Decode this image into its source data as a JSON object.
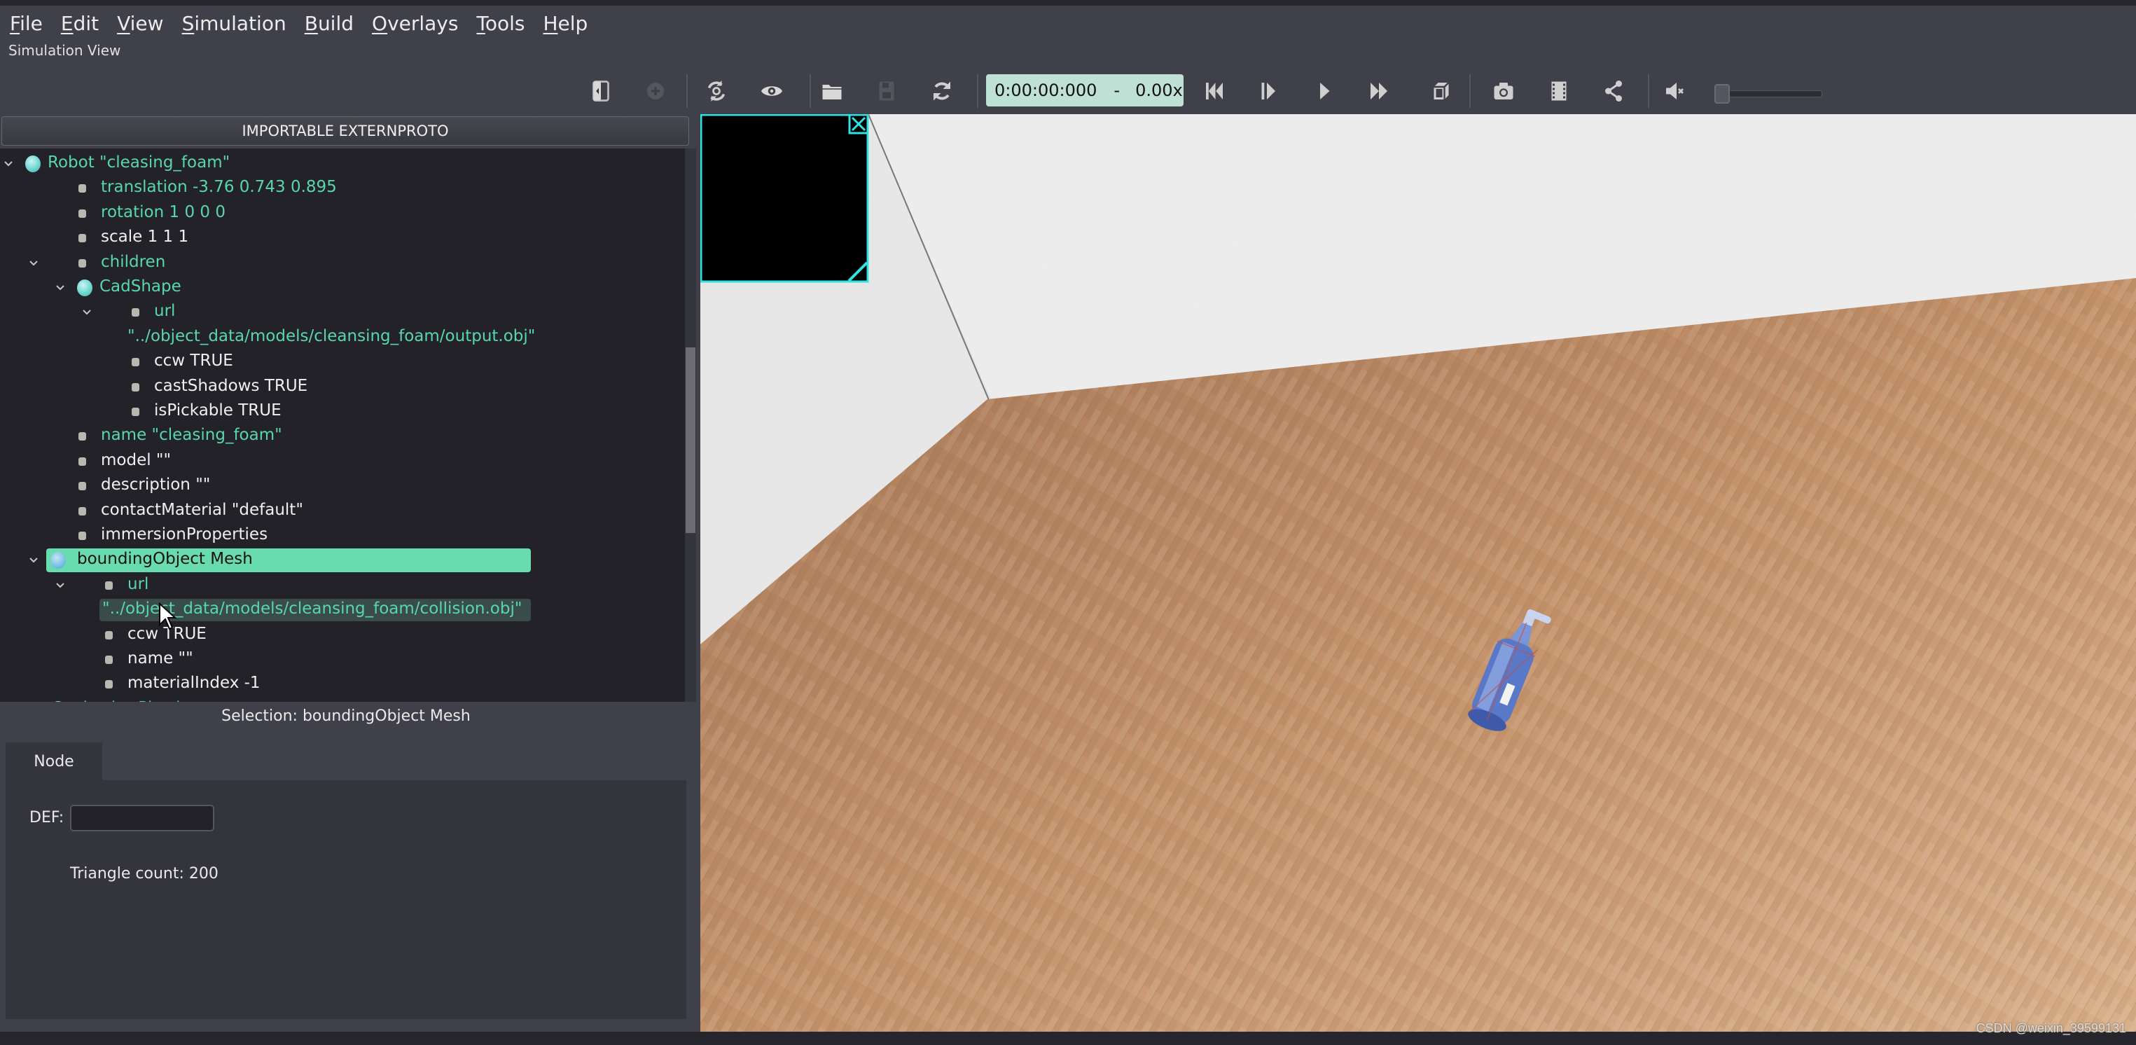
{
  "menu": {
    "items": [
      {
        "label": "File",
        "mnemonic": "F"
      },
      {
        "label": "Edit",
        "mnemonic": "E"
      },
      {
        "label": "View",
        "mnemonic": "V"
      },
      {
        "label": "Simulation",
        "mnemonic": "S"
      },
      {
        "label": "Build",
        "mnemonic": "B"
      },
      {
        "label": "Overlays",
        "mnemonic": "O"
      },
      {
        "label": "Tools",
        "mnemonic": "T"
      },
      {
        "label": "Help",
        "mnemonic": "H"
      }
    ]
  },
  "window": {
    "subtitle": "Simulation View"
  },
  "toolbar": {
    "buttons": [
      {
        "name": "toggle-scene-tree",
        "icon": "panel-toggle-icon",
        "enabled": true
      },
      {
        "name": "add-node",
        "icon": "plus-circle-icon",
        "enabled": false
      },
      {
        "name": "reset-view",
        "icon": "rotate-view-icon",
        "enabled": true
      },
      {
        "name": "view-options",
        "icon": "eye-icon",
        "enabled": true
      },
      {
        "name": "open-world",
        "icon": "folder-icon",
        "enabled": true
      },
      {
        "name": "save-world",
        "icon": "floppy-disk-icon",
        "enabled": false
      },
      {
        "name": "reload-world",
        "icon": "reload-icon",
        "enabled": true
      },
      {
        "name": "reset-simulation",
        "icon": "skip-back-icon",
        "enabled": true
      },
      {
        "name": "step",
        "icon": "step-icon",
        "enabled": true
      },
      {
        "name": "play",
        "icon": "play-icon",
        "enabled": true
      },
      {
        "name": "fast-forward",
        "icon": "fast-forward-icon",
        "enabled": true
      },
      {
        "name": "toggle-rendering",
        "icon": "cube-icon",
        "enabled": true
      },
      {
        "name": "screenshot",
        "icon": "camera-icon",
        "enabled": true
      },
      {
        "name": "record-movie",
        "icon": "film-icon",
        "enabled": true
      },
      {
        "name": "share",
        "icon": "share-icon",
        "enabled": true
      },
      {
        "name": "mute",
        "icon": "speaker-mute-icon",
        "enabled": true
      }
    ],
    "time": "0:00:00:000",
    "time_separator": "-",
    "speed": "0.00x",
    "volume": 0
  },
  "scene_tree": {
    "importable_label": "IMPORTABLE EXTERNPROTO",
    "rows": [
      {
        "text": "Robot \"cleasing_foam\"",
        "depth": 0,
        "kind": "node",
        "expanded": true,
        "color": "teal"
      },
      {
        "text": "translation -3.76 0.743 0.895",
        "depth": 1,
        "kind": "field",
        "color": "teal"
      },
      {
        "text": "rotation 1 0 0 0",
        "depth": 1,
        "kind": "field",
        "color": "teal"
      },
      {
        "text": "scale 1 1 1",
        "depth": 1,
        "kind": "field",
        "color": "white"
      },
      {
        "text": "children",
        "depth": 1,
        "kind": "field",
        "expanded": true,
        "color": "teal"
      },
      {
        "text": "CadShape",
        "depth": 2,
        "kind": "node",
        "expanded": true,
        "color": "teal"
      },
      {
        "text": "url",
        "depth": 3,
        "kind": "field",
        "expanded": true,
        "color": "teal"
      },
      {
        "text": "\"../object_data/models/cleansing_foam/output.obj\"",
        "depth": 4,
        "kind": "value",
        "color": "teal"
      },
      {
        "text": "ccw TRUE",
        "depth": 3,
        "kind": "field",
        "color": "white"
      },
      {
        "text": "castShadows TRUE",
        "depth": 3,
        "kind": "field",
        "color": "white"
      },
      {
        "text": "isPickable TRUE",
        "depth": 3,
        "kind": "field",
        "color": "white"
      },
      {
        "text": "name \"cleasing_foam\"",
        "depth": 1,
        "kind": "field",
        "color": "teal"
      },
      {
        "text": "model \"\"",
        "depth": 1,
        "kind": "field",
        "color": "white"
      },
      {
        "text": "description \"\"",
        "depth": 1,
        "kind": "field",
        "color": "white"
      },
      {
        "text": "contactMaterial \"default\"",
        "depth": 1,
        "kind": "field",
        "color": "white"
      },
      {
        "text": "immersionProperties",
        "depth": 1,
        "kind": "field",
        "color": "white"
      },
      {
        "text": "boundingObject Mesh",
        "depth": 1,
        "kind": "node",
        "expanded": true,
        "selected": true
      },
      {
        "text": "url",
        "depth": 2,
        "kind": "field",
        "expanded": true,
        "color": "teal"
      },
      {
        "text": "\"../object_data/models/cleansing_foam/collision.obj\"",
        "depth": 3,
        "kind": "value",
        "color": "teal",
        "highlighted": true
      },
      {
        "text": "ccw TRUE",
        "depth": 2,
        "kind": "field",
        "color": "white"
      },
      {
        "text": "name \"\"",
        "depth": 2,
        "kind": "field",
        "color": "white"
      },
      {
        "text": "materialIndex -1",
        "depth": 2,
        "kind": "field",
        "color": "white"
      },
      {
        "text": "physics Physics",
        "depth": 1,
        "kind": "node",
        "expanded": false,
        "color": "teal"
      }
    ]
  },
  "selection": {
    "label": "Selection: boundingObject Mesh"
  },
  "node_panel": {
    "tab_label": "Node",
    "def_label": "DEF:",
    "def_value": "",
    "triangle_count": "Triangle count: 200"
  },
  "viewport": {
    "watermark": "CSDN @weixin_39599131"
  },
  "colors": {
    "accent_teal": "#58d6ac",
    "selection_bg": "#69dcaf",
    "overlay_cyan": "#2de3e3",
    "time_box": "#bfe0d5"
  }
}
